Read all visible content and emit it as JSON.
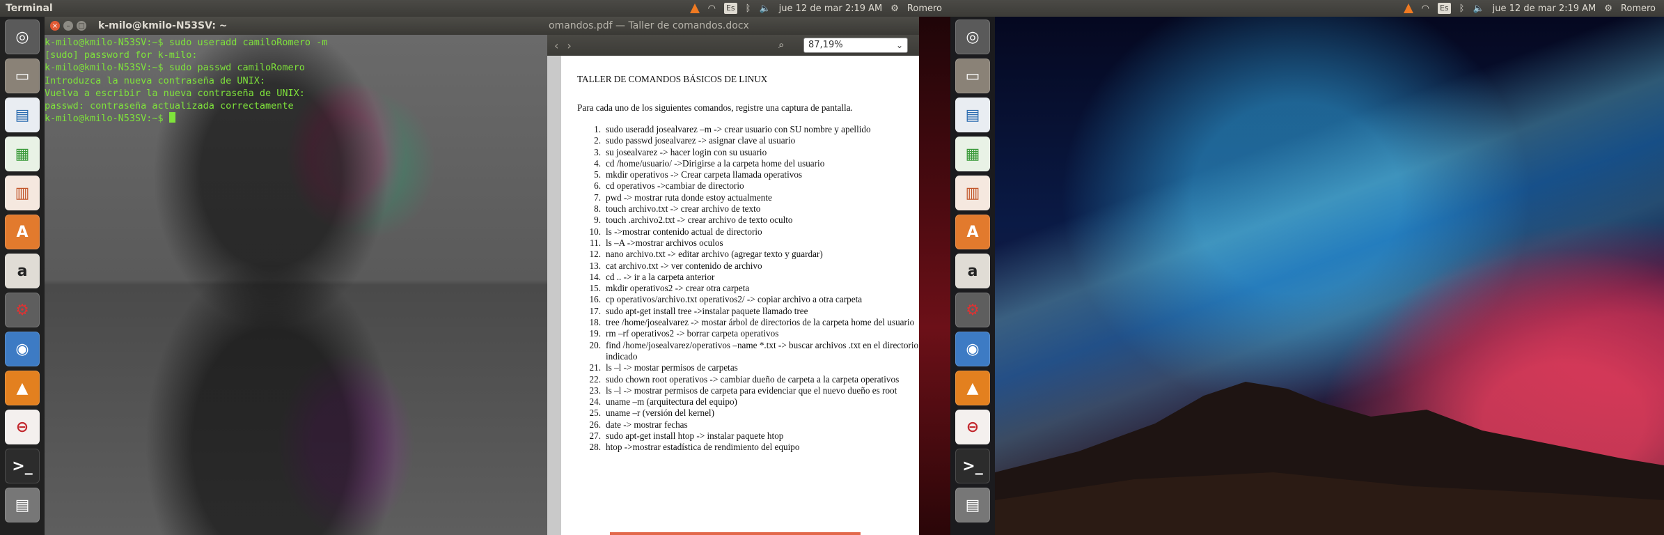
{
  "left_panel": {
    "app_title": "Terminal",
    "date_time": "jue 12 de mar  2:19 AM",
    "user": "Romero",
    "keyboard": "Es"
  },
  "right_panel": {
    "date_time": "jue 12 de mar  2:19 AM",
    "user": "Romero",
    "keyboard": "Es"
  },
  "launcher_items": [
    "dash-home",
    "files",
    "writer",
    "calc",
    "impress",
    "software-center",
    "amazon",
    "settings",
    "chromium",
    "vlc",
    "ubuntu-one",
    "terminal",
    "workspaces"
  ],
  "terminal": {
    "title": "k-milo@kmilo-N53SV: ~",
    "lines": [
      "k-milo@kmilo-N53SV:~$ sudo useradd camiloRomero -m",
      "[sudo] password for k-milo:",
      "k-milo@kmilo-N53SV:~$ sudo passwd camiloRomero",
      "Introduzca la nueva contraseña de UNIX:",
      "Vuelva a escribir la nueva contraseña de UNIX:",
      "passwd: contraseña actualizada correctamente",
      "k-milo@kmilo-N53SV:~$ "
    ]
  },
  "viewer": {
    "title": "omandos.pdf — Taller de comandos.docx",
    "zoom": "87,19%",
    "doc_title": "TALLER DE COMANDOS BÁSICOS DE LINUX",
    "doc_intro": "Para cada uno de los siguientes comandos, registre una captura de pantalla.",
    "items": [
      {
        "n": "1.",
        "text": "sudo  useradd josealvarez –m -> crear usuario con SU nombre y apellido"
      },
      {
        "n": "2.",
        "text": "sudo passwd josealvarez -> asignar clave al usuario"
      },
      {
        "n": "3.",
        "text": "su josealvarez -> hacer login con su usuario"
      },
      {
        "n": "4.",
        "text": "cd /home/usuario/ ->Dirigirse a la carpeta home del usuario"
      },
      {
        "n": "5.",
        "text": "mkdir operativos -> Crear carpeta llamada operativos"
      },
      {
        "n": "6.",
        "text": "cd operativos ->cambiar de directorio"
      },
      {
        "n": "7.",
        "text": "pwd -> mostrar ruta donde estoy actualmente"
      },
      {
        "n": "8.",
        "text": "touch archivo.txt -> crear archivo de texto"
      },
      {
        "n": "9.",
        "text": "touch .archivo2.txt -> crear archivo de texto oculto"
      },
      {
        "n": "10.",
        "text": "ls ->mostrar contenido actual de directorio"
      },
      {
        "n": "11.",
        "text": "ls –A ->mostrar archivos oculos"
      },
      {
        "n": "12.",
        "text": "nano archivo.txt -> editar archivo (agregar texto y guardar)"
      },
      {
        "n": "13.",
        "text": "cat archivo.txt -> ver contenido de archivo"
      },
      {
        "n": "14.",
        "text": "cd .. -> ir a la carpeta anterior"
      },
      {
        "n": "15.",
        "text": "mkdir operativos2 -> crear otra carpeta"
      },
      {
        "n": "16.",
        "text": "cp operativos/archivo.txt operativos2/ -> copiar archivo a otra carpeta"
      },
      {
        "n": "17.",
        "text": "sudo apt-get install tree ->instalar paquete llamado tree"
      },
      {
        "n": "18.",
        "text": "tree /home/josealvarez -> mostar árbol de directorios de la carpeta home del usuario",
        "wrap": true
      },
      {
        "n": "19.",
        "text": "rm –rf operativos2 -> borrar carpeta operativos"
      },
      {
        "n": "20.",
        "text": "find /home/josealvarez/operativos –name *.txt -> buscar archivos .txt en el directorio indicado",
        "wrap": true
      },
      {
        "n": "21.",
        "text": "ls –l -> mostar permisos de carpetas"
      },
      {
        "n": "22.",
        "text": "sudo chown root operativos -> cambiar dueño de carpeta a la carpeta operativos",
        "wrap": true
      },
      {
        "n": "23.",
        "text": "ls –l -> mostrar permisos de carpeta para evidenciar que el nuevo dueño es root"
      },
      {
        "n": "24.",
        "text": "uname –m (arquitectura del equipo)"
      },
      {
        "n": "25.",
        "text": "uname –r (versión del kernel)"
      },
      {
        "n": "26.",
        "text": "date -> mostrar fechas"
      },
      {
        "n": "27.",
        "text": "sudo apt-get install htop -> instalar paquete htop"
      },
      {
        "n": "28.",
        "text": "htop ->mostrar estadística de rendimiento del equipo"
      }
    ]
  },
  "colors": {
    "terminal_text": "#7fe33b",
    "panel_bg": "#3c3b37",
    "close_button": "#e25a34",
    "accent_orange": "#f07a22"
  }
}
